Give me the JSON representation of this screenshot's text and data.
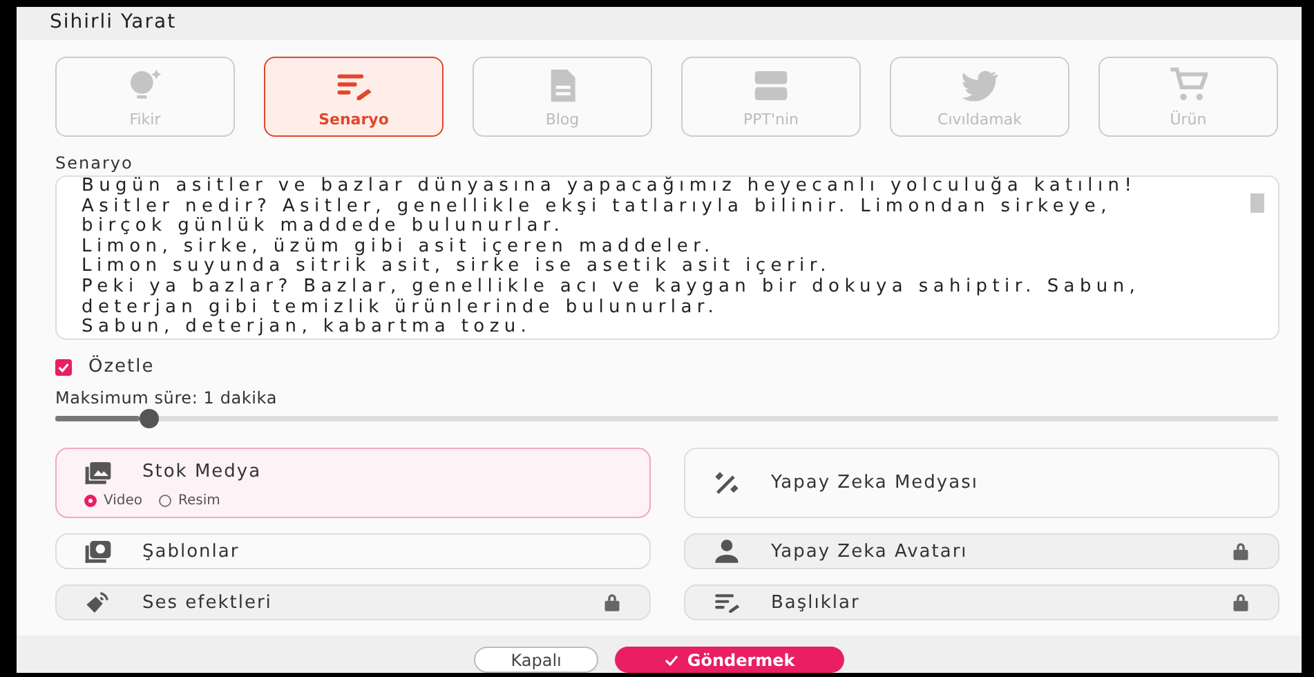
{
  "window": {
    "title": "Sihirli Yarat"
  },
  "modes": [
    {
      "label": "Fikir",
      "selected": false
    },
    {
      "label": "Senaryo",
      "selected": true
    },
    {
      "label": "Blog",
      "selected": false
    },
    {
      "label": "PPT'nin",
      "selected": false
    },
    {
      "label": "Cıvıldamak",
      "selected": false
    },
    {
      "label": "Ürün",
      "selected": false
    }
  ],
  "script": {
    "label": "Senaryo",
    "value": "Bugün asitler ve bazlar dünyasına yapacağımız heyecanlı yolculuğa katılın!\nAsitler nedir? Asitler, genellikle ekşi tatlarıyla bilinir. Limondan sirkeye, birçok günlük maddede bulunurlar.\nLimon, sirke, üzüm gibi asit içeren maddeler.\nLimon suyunda sitrik asit, sirke ise asetik asit içerir.\nPeki ya bazlar? Bazlar, genellikle acı ve kaygan bir dokuya sahiptir. Sabun, deterjan gibi temizlik ürünlerinde bulunurlar.\nSabun, deterjan, kabartma tozu."
  },
  "summarize": {
    "label": "Özetle",
    "checked": true
  },
  "duration": {
    "label": "Maksimum süre: 1 dakika",
    "level": 0.077
  },
  "options": [
    {
      "label": "Stok Medya",
      "selected": true,
      "locked": false,
      "choices": [
        {
          "label": "Video",
          "selected": true
        },
        {
          "label": "Resim",
          "selected": false
        }
      ]
    },
    {
      "label": "Yapay Zeka Medyası",
      "selected": false,
      "locked": false
    },
    {
      "label": "Şablonlar",
      "selected": false,
      "locked": false
    },
    {
      "label": "Yapay Zeka Avatarı",
      "selected": false,
      "locked": true
    },
    {
      "label": "Ses efektleri",
      "selected": false,
      "locked": true
    },
    {
      "label": "Başlıklar",
      "selected": false,
      "locked": true
    }
  ],
  "buttons": [
    {
      "label": "Kapalı",
      "kind": "secondary"
    },
    {
      "label": "Göndermek",
      "kind": "primary"
    }
  ]
}
